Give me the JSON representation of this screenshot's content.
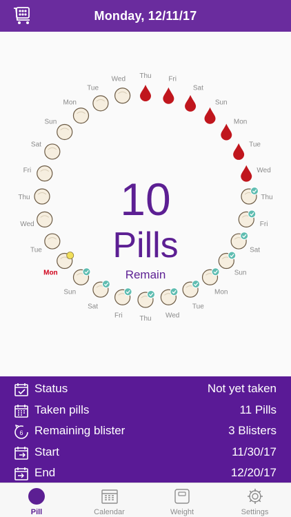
{
  "header": {
    "title": "Monday, 12/11/17",
    "left_icon": "pill-cart-icon"
  },
  "dial": {
    "count": "10",
    "unit": "Pills",
    "caption": "Remain",
    "current_day_index": 24,
    "days": [
      {
        "label": "Thu",
        "kind": "drop"
      },
      {
        "label": "Fri",
        "kind": "drop"
      },
      {
        "label": "Sat",
        "kind": "drop"
      },
      {
        "label": "Sun",
        "kind": "drop"
      },
      {
        "label": "Mon",
        "kind": "drop"
      },
      {
        "label": "Tue",
        "kind": "drop"
      },
      {
        "label": "Wed",
        "kind": "drop"
      },
      {
        "label": "Thu",
        "kind": "taken"
      },
      {
        "label": "Fri",
        "kind": "taken"
      },
      {
        "label": "Sat",
        "kind": "taken"
      },
      {
        "label": "Sun",
        "kind": "taken"
      },
      {
        "label": "Mon",
        "kind": "taken"
      },
      {
        "label": "Tue",
        "kind": "taken"
      },
      {
        "label": "Wed",
        "kind": "taken"
      },
      {
        "label": "Thu",
        "kind": "taken"
      },
      {
        "label": "Fri",
        "kind": "taken"
      },
      {
        "label": "Sat",
        "kind": "taken"
      },
      {
        "label": "Sun",
        "kind": "taken"
      },
      {
        "label": "Mon",
        "kind": "today"
      },
      {
        "label": "Tue",
        "kind": "pill"
      },
      {
        "label": "Wed",
        "kind": "pill"
      },
      {
        "label": "Thu",
        "kind": "pill"
      },
      {
        "label": "Fri",
        "kind": "pill"
      },
      {
        "label": "Sat",
        "kind": "pill"
      },
      {
        "label": "Sun",
        "kind": "pill"
      },
      {
        "label": "Mon",
        "kind": "pill"
      },
      {
        "label": "Tue",
        "kind": "pill"
      },
      {
        "label": "Wed",
        "kind": "pill"
      }
    ]
  },
  "info": {
    "rows": [
      {
        "icon": "calendar-check-icon",
        "label": "Status",
        "value": "Not yet taken"
      },
      {
        "icon": "calendar-grid-icon",
        "label": "Taken pills",
        "value": "11 Pills"
      },
      {
        "icon": "blister-count-icon",
        "label": "Remaining blister",
        "value": "3  Blisters",
        "icon_text": "6"
      },
      {
        "icon": "calendar-start-icon",
        "label": "Start",
        "value": "11/30/17"
      },
      {
        "icon": "calendar-end-icon",
        "label": "End",
        "value": "12/20/17"
      }
    ]
  },
  "tabs": [
    {
      "label": "Pill",
      "icon": "pill-tab-icon",
      "active": true
    },
    {
      "label": "Calendar",
      "icon": "calendar-tab-icon",
      "active": false
    },
    {
      "label": "Weight",
      "icon": "scale-tab-icon",
      "active": false
    },
    {
      "label": "Settings",
      "icon": "gear-tab-icon",
      "active": false
    }
  ],
  "colors": {
    "header": "#6a2c9e",
    "panel": "#5a1a96",
    "accent_text": "#5c1f93",
    "drop": "#c0161d",
    "check": "#5fbdb1",
    "today_dot": "#f1df5a",
    "today_label": "#d0021b"
  }
}
